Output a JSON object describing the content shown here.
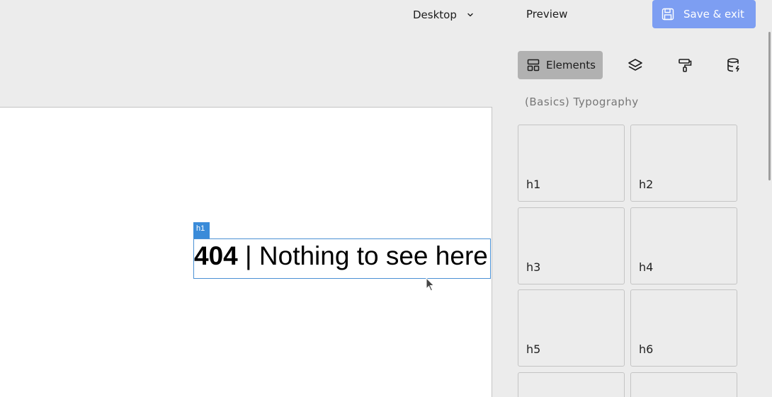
{
  "topbar": {
    "device_label": "Desktop",
    "preview_label": "Preview",
    "save_label": "Save & exit"
  },
  "canvas": {
    "selected_tag": "h1",
    "heading_bold": "404",
    "heading_rest": " | Nothing to see here"
  },
  "sidebar": {
    "tabs": [
      {
        "label": "Elements",
        "icon": "layout-icon",
        "active": true
      },
      {
        "label": "",
        "icon": "layers-icon",
        "active": false
      },
      {
        "label": "",
        "icon": "paint-roller-icon",
        "active": false
      },
      {
        "label": "",
        "icon": "database-icon",
        "active": false
      }
    ],
    "section_title": "(Basics) Typography",
    "items": [
      {
        "label": "h1"
      },
      {
        "label": "h2"
      },
      {
        "label": "h3"
      },
      {
        "label": "h4"
      },
      {
        "label": "h5"
      },
      {
        "label": "h6"
      },
      {
        "label": ""
      },
      {
        "label": ""
      }
    ]
  },
  "colors": {
    "accent": "#7d9ef2",
    "selection": "#3a8bd9",
    "background": "#ececec"
  }
}
